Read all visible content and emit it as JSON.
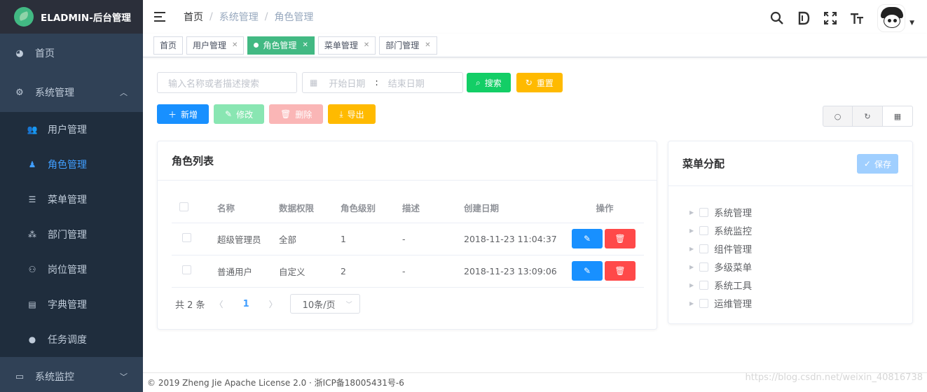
{
  "app": {
    "title": "ELADMIN-后台管理"
  },
  "sidebar": {
    "home": "首页",
    "system": "系统管理",
    "monitor": "系统监控",
    "items": [
      "用户管理",
      "角色管理",
      "菜单管理",
      "部门管理",
      "岗位管理",
      "字典管理",
      "任务调度"
    ]
  },
  "breadcrumb": [
    "首页",
    "系统管理",
    "角色管理"
  ],
  "tags": [
    "首页",
    "用户管理",
    "角色管理",
    "菜单管理",
    "部门管理"
  ],
  "search": {
    "keyword_placeholder": "输入名称或者描述搜索",
    "start_date_placeholder": "开始日期",
    "date_separator": ":",
    "end_date_placeholder": "结束日期",
    "search_label": "搜索",
    "reset_label": "重置"
  },
  "crud": {
    "add": "新增",
    "edit": "修改",
    "delete": "删除",
    "export": "导出"
  },
  "role_card": {
    "title": "角色列表",
    "columns": [
      "名称",
      "数据权限",
      "角色级别",
      "描述",
      "创建日期",
      "操作"
    ],
    "rows": [
      {
        "name": "超级管理员",
        "scope": "全部",
        "level": "1",
        "desc": "-",
        "created": "2018-11-23 11:04:37"
      },
      {
        "name": "普通用户",
        "scope": "自定义",
        "level": "2",
        "desc": "-",
        "created": "2018-11-23 13:09:06"
      }
    ],
    "pagination": {
      "total": "共 2 条",
      "current": "1",
      "page_size": "10条/页"
    }
  },
  "menu_card": {
    "title": "菜单分配",
    "save": "保存",
    "nodes": [
      "系统管理",
      "系统监控",
      "组件管理",
      "多级菜单",
      "系统工具",
      "运维管理"
    ]
  },
  "footer": {
    "text": "© 2019 Zheng Jie Apache License 2.0 · 浙ICP备18005431号-6"
  },
  "watermark": "https://blog.csdn.net/weixin_40816738",
  "colors": {
    "sidebar": "#304156",
    "active": "#409eff",
    "tag_active": "#42b983",
    "primary": "#1890ff",
    "success": "#13ce66",
    "warning": "#ffba00",
    "danger": "#ff4949"
  }
}
